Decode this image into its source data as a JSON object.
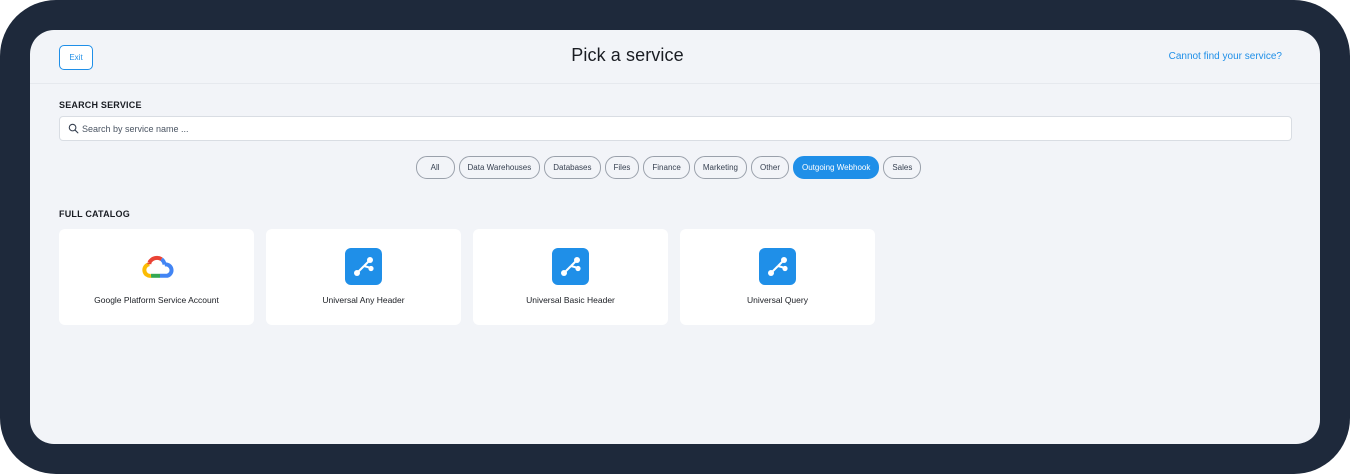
{
  "header": {
    "exit_label": "Exit",
    "title": "Pick a service",
    "cant_find_label": "Cannot find your service?"
  },
  "search": {
    "label": "SEARCH SERVICE",
    "placeholder": "Search by service name ...",
    "value": ""
  },
  "filters": {
    "items": [
      {
        "label": "All",
        "active": false
      },
      {
        "label": "Data Warehouses",
        "active": false
      },
      {
        "label": "Databases",
        "active": false
      },
      {
        "label": "Files",
        "active": false
      },
      {
        "label": "Finance",
        "active": false
      },
      {
        "label": "Marketing",
        "active": false
      },
      {
        "label": "Other",
        "active": false
      },
      {
        "label": "Outgoing Webhook",
        "active": true
      },
      {
        "label": "Sales",
        "active": false
      }
    ]
  },
  "catalog": {
    "label": "FULL CATALOG",
    "cards": [
      {
        "label": "Google Platform Service Account",
        "icon": "google-cloud-icon"
      },
      {
        "label": "Universal Any Header",
        "icon": "webhook-icon"
      },
      {
        "label": "Universal Basic Header",
        "icon": "webhook-icon"
      },
      {
        "label": "Universal Query",
        "icon": "webhook-icon"
      }
    ]
  },
  "colors": {
    "accent": "#1f8fe8",
    "frame": "#1e293b",
    "background": "#f2f4f8"
  }
}
